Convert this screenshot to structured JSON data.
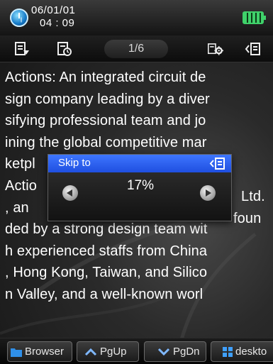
{
  "status": {
    "date": "06/01/01",
    "time": "04 : 09"
  },
  "toolbar": {
    "page": "1/6"
  },
  "reader": {
    "lines": [
      "Actions: An integrated circuit de",
      "sign company leading by a diver",
      "sifying professional team and jo",
      "ining the global competitive mar",
      "ketpl",
      "Actio",
      ", an",
      "ded by a strong design team wit",
      "h experienced staffs from China",
      ", Hong Kong, Taiwan, and Silico",
      "n Valley, and a well-known worl"
    ],
    "partial_right": {
      "line5": "Ltd.",
      "line6": "foun"
    }
  },
  "dialog": {
    "title": "Skip to",
    "value": "17%"
  },
  "bottombar": {
    "browser": "Browser",
    "pgup": "PgUp",
    "pgdn": "PgDn",
    "desktop": "deskto"
  },
  "colors": {
    "dialog_title": "#2f62f5",
    "battery": "#3fd16a"
  }
}
